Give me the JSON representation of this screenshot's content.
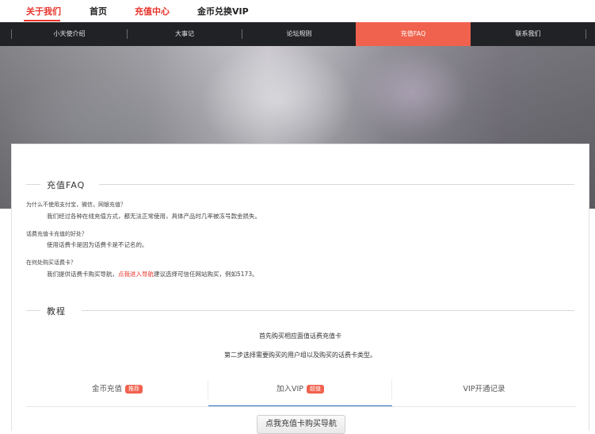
{
  "top_nav": {
    "items": [
      "关于我们",
      "首页",
      "充值中心",
      "金币兑换VIP"
    ]
  },
  "sub_nav": {
    "items": [
      "小天使介绍",
      "大事记",
      "论坛规则",
      "充值FAQ",
      "联系我们"
    ],
    "active": "充值FAQ"
  },
  "faq": {
    "title": "充值FAQ",
    "items": [
      {
        "question": "为什么不使用支付宝，微信，网银充值？",
        "answer": "我们经过各种在线充值方式，都无法正常使用，具体产品时几率被冻号款金损失。"
      },
      {
        "question": "话费充值卡充值的好处？",
        "answer": "使用话费卡是因为话费卡是不记名的。"
      },
      {
        "question": "在何处购买话费卡？",
        "answer_before": "我们提供话费卡购买导航，",
        "answer_link": "点我进入导航",
        "answer_after": "建议选择可信任网站购买，例如5173。"
      }
    ]
  },
  "tutorial": {
    "title": "教程",
    "step1": "首先购买相应面值话费充值卡",
    "step2": "第二步选择需要购买的用户组以及购买的话费卡类型。",
    "tabs": [
      {
        "label": "金币充值",
        "badge": "推荐"
      },
      {
        "label": "加入VIP",
        "badge": "超值"
      },
      {
        "label": "VIP开通记录",
        "badge": ""
      }
    ],
    "active_tab": "加入VIP",
    "buy_button": "点我充值卡购买导航"
  }
}
